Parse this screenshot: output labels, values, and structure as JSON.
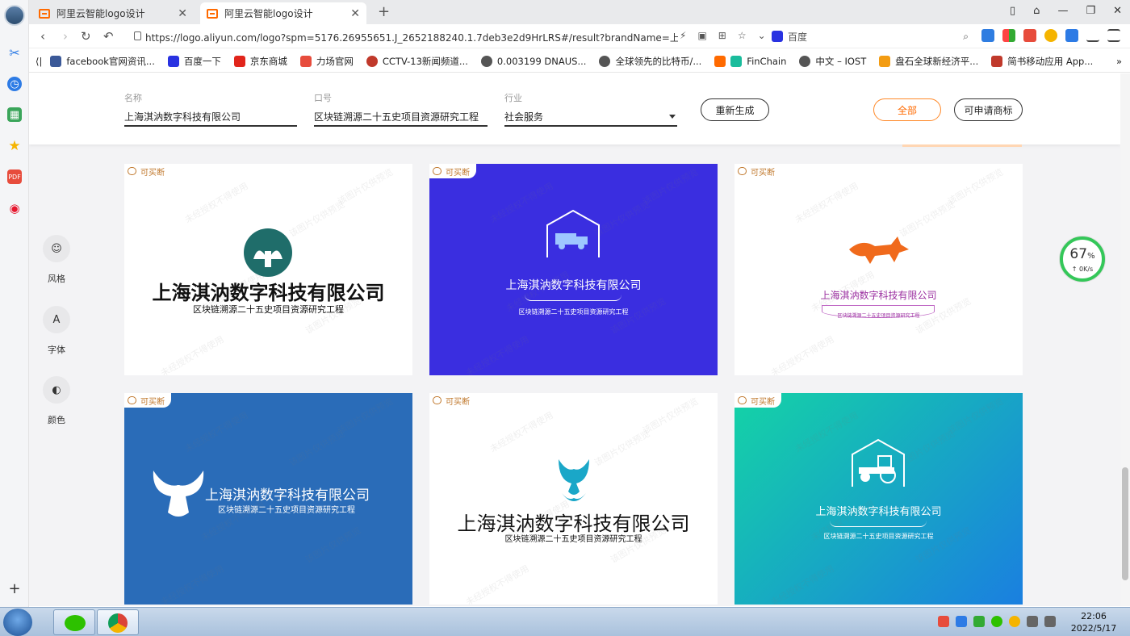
{
  "browser": {
    "tabs": [
      {
        "title": "阿里云智能logo设计",
        "active": false
      },
      {
        "title": "阿里云智能logo设计",
        "active": true
      }
    ],
    "url": "https://logo.aliyun.com/logo?spm=5176.26955651.J_2652188240.1.7deb3e2d9HrLRS#/result?brandName=上...",
    "search_engine": "百度",
    "bookmarks": [
      "facebook官网资讯...",
      "百度一下",
      "京东商城",
      "力场官网",
      "CCTV-13新闻频道...",
      "0.003199 DNAUS...",
      "全球领先的比特币/...",
      "FinChain",
      "中文 – IOST",
      "盘石全球新经济平...",
      "简书移动应用 App..."
    ]
  },
  "filters": {
    "name_label": "名称",
    "name_value": "上海淇汭数字科技有限公司",
    "slogan_label": "口号",
    "slogan_value": "区块链溯源二十五史项目资源研究工程",
    "industry_label": "行业",
    "industry_value": "社会服务",
    "regenerate_label": "重新生成",
    "all_label": "全部",
    "trademark_label": "可申请商标"
  },
  "side_options": [
    {
      "label": "风格",
      "icon": "☺"
    },
    {
      "label": "字体",
      "icon": "A"
    },
    {
      "label": "颜色",
      "icon": "◐"
    }
  ],
  "cards": [
    {
      "badge": "可买断",
      "name": "上海淇汭数字科技有限公司",
      "slogan": "区块链溯源二十五史项目资源研究工程",
      "bg": "#ffffff",
      "fg": "#111111",
      "icon": "leaf-seal-icon",
      "iconColor": "#1f6d6a"
    },
    {
      "badge": "可买断",
      "name": "上海淇汭数字科技有限公司",
      "slogan": "区块链溯源二十五史项目资源研究工程",
      "bg": "#3a2ee0",
      "fg": "#ffffff",
      "icon": "truck-house-icon",
      "iconColor": "#ffffff"
    },
    {
      "badge": "可买断",
      "name": "上海淇汭数字科技有限公司",
      "slogan": "区块链溯源二十五史项目资源研究工程",
      "bg": "#ffffff",
      "fg": "#9b2fa0",
      "icon": "fox-icon",
      "iconColor": "#f06a1c"
    },
    {
      "badge": "可买断",
      "name": "上海淇汭数字科技有限公司",
      "slogan": "区块链溯源二十五史项目资源研究工程",
      "bg": "#2a6cb8",
      "fg": "#ffffff",
      "icon": "eagle-icon",
      "iconColor": "#ffffff"
    },
    {
      "badge": "可买断",
      "name": "上海淇汭数字科技有限公司",
      "slogan": "区块链溯源二十五史项目资源研究工程",
      "bg": "#ffffff",
      "fg": "#111111",
      "icon": "phoenix-icon",
      "iconColor": "#1aa7c8"
    },
    {
      "badge": "可买断",
      "name": "上海淇汭数字科技有限公司",
      "slogan": "区块链溯源二十五史项目资源研究工程",
      "bg": "#17c8a4",
      "fg": "#ffffff",
      "icon": "tractor-house-icon",
      "iconColor": "#ffffff"
    }
  ],
  "watermark": "未经授权不得使用",
  "watermark2": "该图片仅供预览",
  "speed": {
    "percent": "67",
    "unit": "%",
    "rate": "0K/s",
    "level": 0.67
  },
  "taskbar": {
    "time": "22:06",
    "date": "2022/5/17"
  }
}
